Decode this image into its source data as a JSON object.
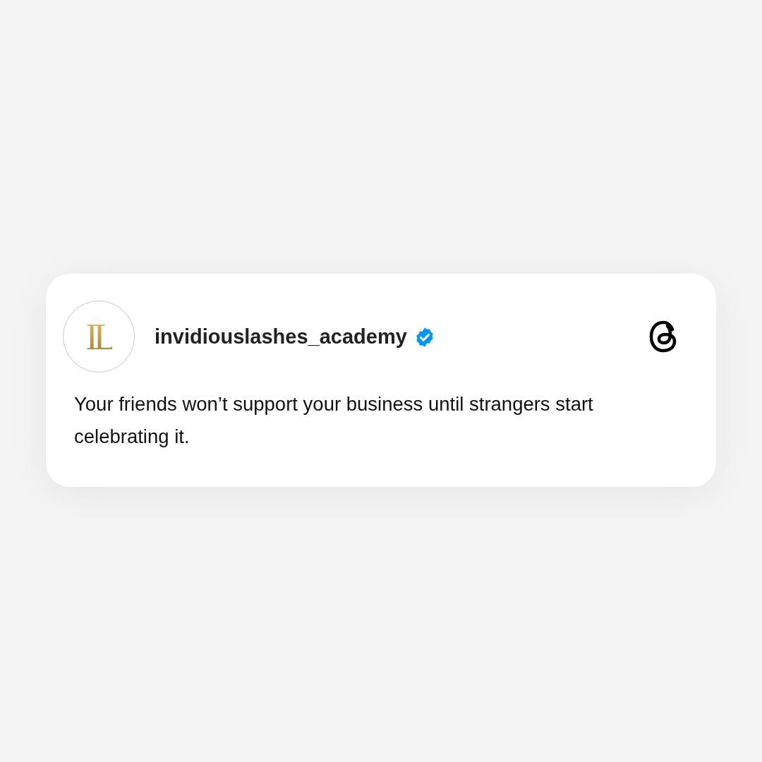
{
  "post": {
    "avatar": {
      "initials": "IL"
    },
    "username": "invidiouslashes_academy",
    "verified": true,
    "text": "Your friends won’t support your business until strangers start celebrating it."
  }
}
